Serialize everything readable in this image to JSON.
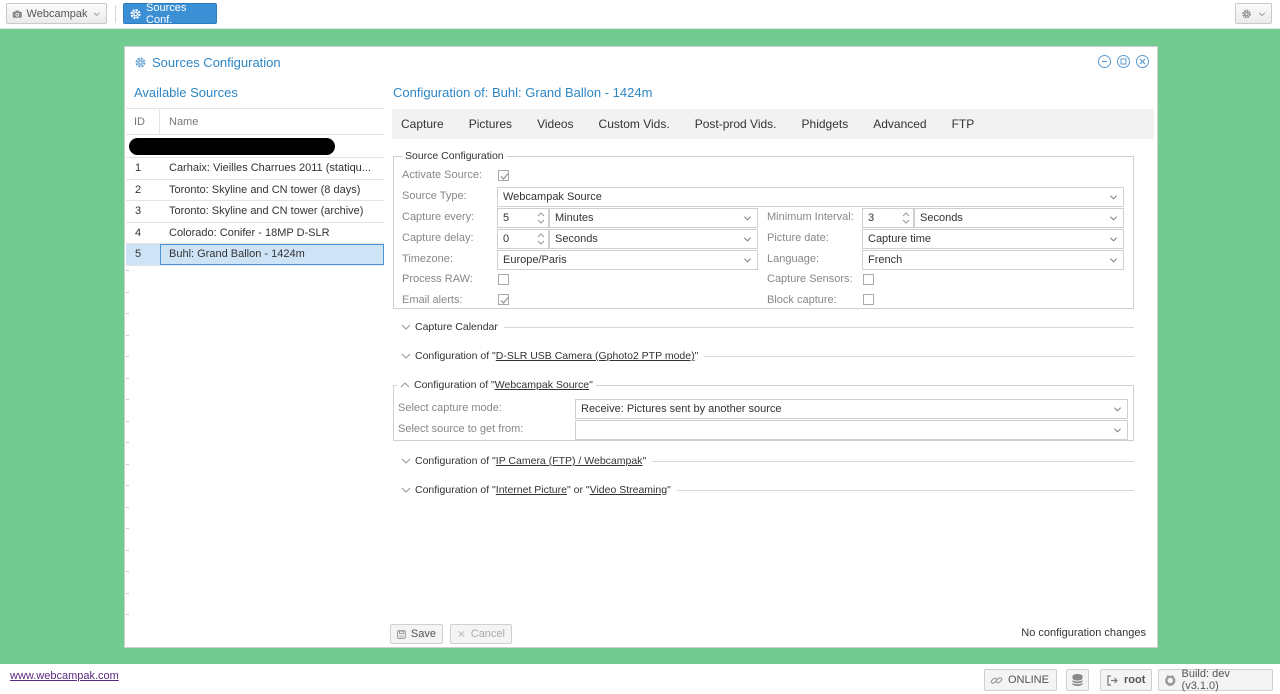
{
  "toolbar": {
    "app_menu_label": "Webcampak",
    "active_button_label": "Sources Conf."
  },
  "window": {
    "title": "Sources Configuration"
  },
  "sources": {
    "header": "Available Sources",
    "col_id": "ID",
    "col_name": "Name",
    "rows": [
      {
        "id": "1",
        "name": "Carhaix: Vieilles Charrues 2011 (statiqu..."
      },
      {
        "id": "2",
        "name": "Toronto: Skyline and CN tower (8 days)"
      },
      {
        "id": "3",
        "name": "Toronto: Skyline and CN tower (archive)"
      },
      {
        "id": "4",
        "name": "Colorado: Conifer - 18MP D-SLR"
      },
      {
        "id": "5",
        "name": "Buhl: Grand Ballon - 1424m"
      }
    ]
  },
  "config": {
    "title": "Configuration of: Buhl: Grand Ballon - 1424m",
    "tabs": [
      "Capture",
      "Pictures",
      "Videos",
      "Custom Vids.",
      "Post-prod Vids.",
      "Phidgets",
      "Advanced",
      "FTP"
    ],
    "source_config": {
      "legend": "Source Configuration",
      "activate_label": "Activate Source:",
      "activate_checked": true,
      "source_type_label": "Source Type:",
      "source_type_value": "Webcampak Source",
      "capture_every_label": "Capture every:",
      "capture_every_value": "5",
      "capture_every_unit": "Minutes",
      "min_interval_label": "Minimum Interval:",
      "min_interval_value": "3",
      "min_interval_unit": "Seconds",
      "capture_delay_label": "Capture delay:",
      "capture_delay_value": "0",
      "capture_delay_unit": "Seconds",
      "picture_date_label": "Picture date:",
      "picture_date_value": "Capture time",
      "timezone_label": "Timezone:",
      "timezone_value": "Europe/Paris",
      "language_label": "Language:",
      "language_value": "French",
      "process_raw_label": "Process RAW:",
      "process_raw_checked": false,
      "capture_sensors_label": "Capture Sensors:",
      "capture_sensors_checked": false,
      "email_alerts_label": "Email alerts:",
      "email_alerts_checked": true,
      "block_capture_label": "Block capture:",
      "block_capture_checked": false
    },
    "capture_calendar": "Capture Calendar",
    "dslr_prefix": "Configuration of \"",
    "dslr_link": "D-SLR USB Camera (Gphoto2 PTP mode)",
    "dslr_suffix": "\"",
    "webcampak_prefix": "Configuration of \"",
    "webcampak_link": "Webcampak Source",
    "webcampak_suffix": "\"",
    "capture_mode_label": "Select capture mode:",
    "capture_mode_value": "Receive: Pictures sent by another source",
    "source_from_label": "Select source to get from:",
    "source_from_value": "",
    "ipcam_prefix": "Configuration of \"",
    "ipcam_link": "IP Camera (FTP) / Webcampak",
    "ipcam_suffix": "\"",
    "internet_prefix": "Configuration of \"",
    "internet_link": "Internet Picture",
    "internet_mid": "\" or \"",
    "video_link": "Video Streaming",
    "internet_suffix": "\""
  },
  "actions": {
    "save_label": "Save",
    "cancel_label": "Cancel",
    "status": "No configuration changes"
  },
  "footer": {
    "site_link": "www.webcampak.com",
    "online_label": "ONLINE",
    "user_label": "root",
    "build_label": "Build: dev (v3.1.0)"
  }
}
